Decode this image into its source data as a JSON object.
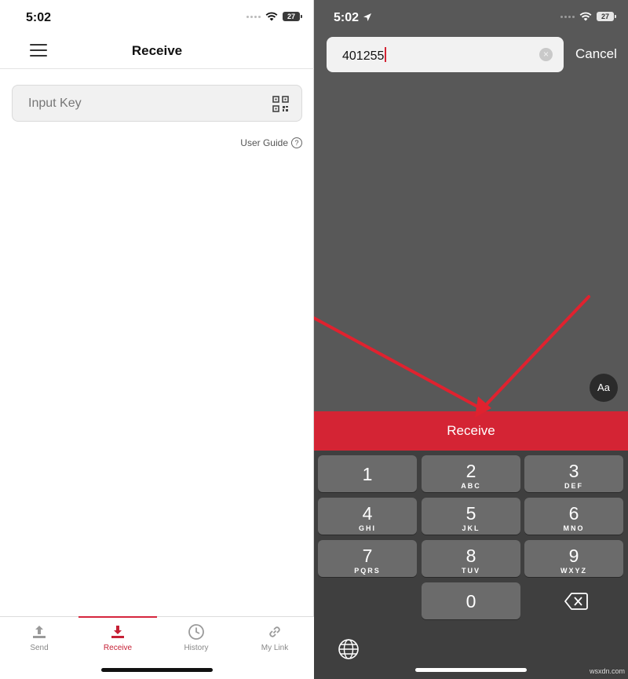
{
  "left": {
    "status": {
      "time": "5:02",
      "battery": "27"
    },
    "nav": {
      "title": "Receive"
    },
    "input": {
      "placeholder": "Input Key"
    },
    "user_guide": {
      "label": "User Guide",
      "icon_glyph": "?"
    },
    "tabs": [
      {
        "label": "Send",
        "icon": "upload-icon",
        "active": false
      },
      {
        "label": "Receive",
        "icon": "download-icon",
        "active": true
      },
      {
        "label": "History",
        "icon": "clock-icon",
        "active": false
      },
      {
        "label": "My Link",
        "icon": "link-icon",
        "active": false
      }
    ]
  },
  "right": {
    "status": {
      "time": "5:02",
      "battery": "27"
    },
    "search": {
      "value": "401255",
      "clear_glyph": "×"
    },
    "cancel_label": "Cancel",
    "aa_label": "Aa",
    "receive_label": "Receive",
    "keypad": [
      {
        "digit": "1",
        "letters": ""
      },
      {
        "digit": "2",
        "letters": "ABC"
      },
      {
        "digit": "3",
        "letters": "DEF"
      },
      {
        "digit": "4",
        "letters": "GHI"
      },
      {
        "digit": "5",
        "letters": "JKL"
      },
      {
        "digit": "6",
        "letters": "MNO"
      },
      {
        "digit": "7",
        "letters": "PQRS"
      },
      {
        "digit": "8",
        "letters": "TUV"
      },
      {
        "digit": "9",
        "letters": "WXYZ"
      },
      {
        "digit": "0",
        "letters": ""
      }
    ]
  },
  "watermark": "wsxdn.com",
  "colors": {
    "accent": "#d42434",
    "overlay": "#585858",
    "keyboard": "#3f3f3f"
  }
}
